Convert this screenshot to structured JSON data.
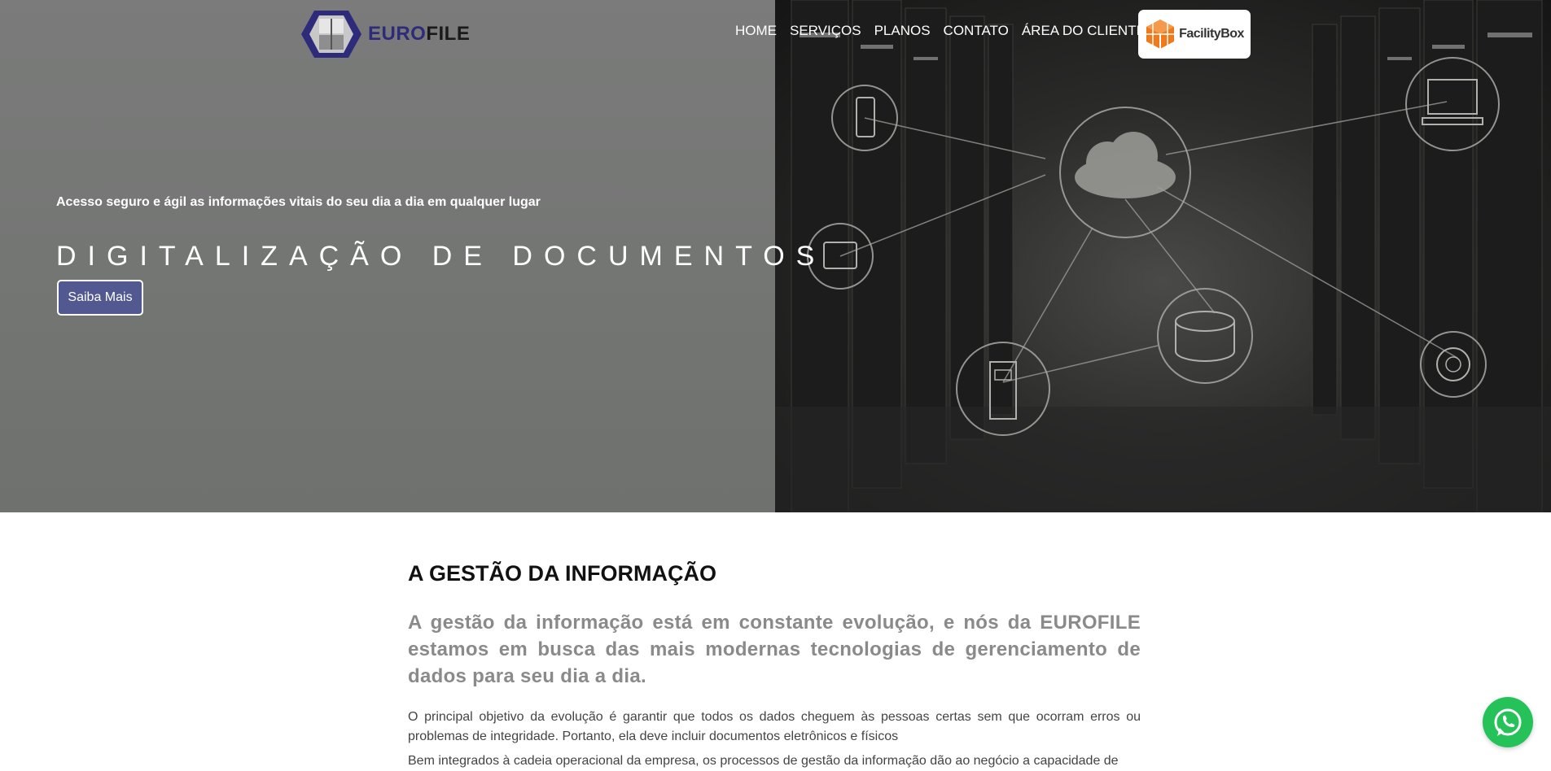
{
  "brand": {
    "logo_euro": "EURO",
    "logo_file": "FILE",
    "logo_color": "#2e2c7a"
  },
  "nav": {
    "items": [
      {
        "label": "HOME"
      },
      {
        "label": "SERVIÇOS"
      },
      {
        "label": "PLANOS"
      },
      {
        "label": "CONTATO"
      },
      {
        "label": "ÁREA DO CLIENTE"
      }
    ],
    "facility_label": "FacilityBox",
    "facility_icon_color": "#f07a1a"
  },
  "hero": {
    "tagline": "Acesso seguro e ágil as informações vitais do seu dia a dia em qualquer lugar",
    "headline": "DIGITALIZAÇÃO DE DOCUMENTOS",
    "cta_label": "Saiba Mais",
    "cta_color": "#525890"
  },
  "section": {
    "title": "A GESTÃO DA INFORMAÇÃO",
    "lead": "A gestão da informação está em constante evolução, e nós da EUROFILE estamos em busca das mais modernas tecnologias de gerenciamento de dados para seu dia a dia.",
    "paragraph1": "O principal objetivo da evolução é garantir que todos os dados cheguem às pessoas certas sem que ocorram erros ou problemas de integridade. Portanto, ela deve incluir documentos eletrônicos e físicos",
    "paragraph2": "Bem integrados à cadeia operacional da empresa, os processos de gestão da informação dão ao negócio a capacidade de"
  },
  "widgets": {
    "whatsapp_icon": "whatsapp-icon",
    "whatsapp_color": "#25c25a"
  }
}
